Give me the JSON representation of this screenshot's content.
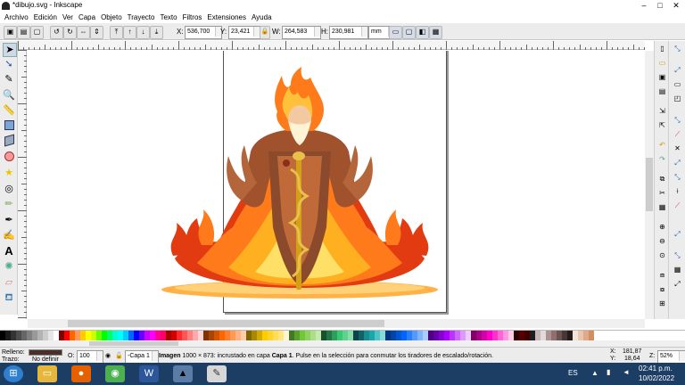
{
  "window": {
    "title": "*dibujo.svg - Inkscape"
  },
  "menu": [
    "Archivo",
    "Edición",
    "Ver",
    "Capa",
    "Objeto",
    "Trayecto",
    "Texto",
    "Filtros",
    "Extensiones",
    "Ayuda"
  ],
  "controls": {
    "x_label": "X:",
    "x_value": "536,700",
    "y_label": "Y:",
    "y_value": "23,421",
    "w_label": "W:",
    "w_value": "264,583",
    "h_label": "H:",
    "h_value": "230,981",
    "unit": "mm"
  },
  "status": {
    "fill_label": "Relleno:",
    "stroke_label": "Trazo:",
    "stroke_value": "No definir",
    "opacity_label": "O:",
    "opacity_value": "100",
    "layer": "-Capa 1",
    "message_bold": "Imagen",
    "message": "1000 × 873: incrustado en capa",
    "message_layer": "Capa 1",
    "message_tail": ". Pulse en la selección para conmutar los tiradores de escalado/rotación.",
    "x_label": "X:",
    "x_coord": "181,87",
    "y_label": "Y:",
    "y_coord": "18,64",
    "zoom_label": "Z:",
    "zoom": "52%"
  },
  "taskbar": {
    "lang": "ES",
    "time": "02:41 p.m.",
    "date": "10/02/2022"
  },
  "palette": [
    "#000000",
    "#1a1a1a",
    "#333333",
    "#4d4d4d",
    "#666666",
    "#808080",
    "#999999",
    "#b3b3b3",
    "#cccccc",
    "#e6e6e6",
    "#ffffff",
    "#800000",
    "#ff0000",
    "#ff6600",
    "#ff9955",
    "#ffcc00",
    "#ffff00",
    "#ccff00",
    "#66ff00",
    "#00ff00",
    "#00ff66",
    "#00ffcc",
    "#00ffff",
    "#00ccff",
    "#0066ff",
    "#0000ff",
    "#6600ff",
    "#cc00ff",
    "#ff00ff",
    "#ff0099",
    "#ff0066",
    "#aa0000",
    "#d40000",
    "#ff2a2a",
    "#ff5555",
    "#ff8080",
    "#ffaaaa",
    "#ffd5d5",
    "#803300",
    "#aa4400",
    "#d45500",
    "#ff6600",
    "#ff7f2a",
    "#ff9955",
    "#ffb380",
    "#ffccaa",
    "#806600",
    "#aa8800",
    "#d4aa00",
    "#ffcc00",
    "#ffd42a",
    "#ffdd55",
    "#ffe680",
    "#fff6d5",
    "#447821",
    "#5aa02c",
    "#71c837",
    "#8dd35f",
    "#aade87",
    "#c6e9af",
    "#16502d",
    "#217844",
    "#2ca05a",
    "#37c871",
    "#5fd38d",
    "#87deaa",
    "#0b4446",
    "#116466",
    "#168d8f",
    "#1aa6aa",
    "#4ec4c7",
    "#8ad9db",
    "#003380",
    "#0044aa",
    "#0055d4",
    "#0066ff",
    "#2a7fff",
    "#5599ff",
    "#80b3ff",
    "#aaccff",
    "#4d0080",
    "#6600aa",
    "#8800d4",
    "#aa00ff",
    "#bb33ff",
    "#cc66ff",
    "#dd99ff",
    "#eeccff",
    "#800066",
    "#aa0088",
    "#d400aa",
    "#ff00cc",
    "#ff33cc",
    "#ff66d4",
    "#ff99e6",
    "#ffcce6",
    "#2b0000",
    "#550000",
    "#400000",
    "#1f1f1f",
    "#c8b7b7",
    "#e3dbdb",
    "#ac9393",
    "#916f6f",
    "#6c5353",
    "#483737",
    "#241c1c",
    "#f4e3d7",
    "#e9c6af",
    "#deaa87",
    "#d38d5f"
  ]
}
